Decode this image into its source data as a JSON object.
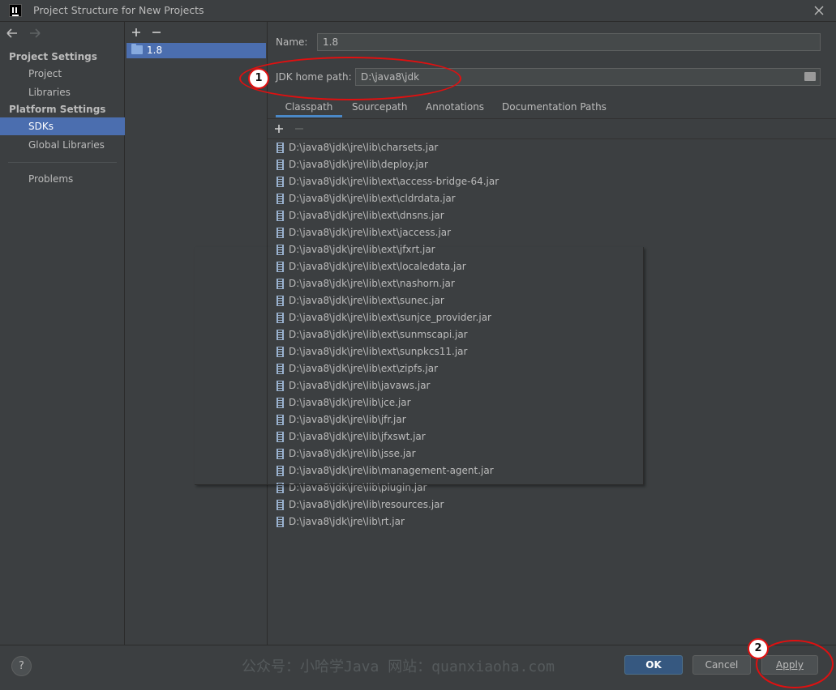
{
  "window": {
    "title": "Project Structure for New Projects",
    "app_icon": "intellij-icon",
    "close_icon": "close-icon"
  },
  "left_nav": {
    "back_icon": "arrow-left-icon",
    "forward_icon": "arrow-right-icon",
    "sections": [
      {
        "label": "Project Settings",
        "items": [
          "Project",
          "Libraries"
        ]
      },
      {
        "label": "Platform Settings",
        "items": [
          "SDKs",
          "Global Libraries"
        ]
      }
    ],
    "selected": "SDKs",
    "problems": "Problems"
  },
  "sdk_list": {
    "add_icon": "plus-icon",
    "remove_icon": "minus-icon",
    "items": [
      "1.8"
    ]
  },
  "detail": {
    "name_label": "Name:",
    "name_value": "1.8",
    "jdk_label": "JDK home path:",
    "jdk_value": "D:\\java8\\jdk",
    "tabs": [
      "Classpath",
      "Sourcepath",
      "Annotations",
      "Documentation Paths"
    ],
    "active_tab": "Classpath",
    "classpath": [
      "D:\\java8\\jdk\\jre\\lib\\charsets.jar",
      "D:\\java8\\jdk\\jre\\lib\\deploy.jar",
      "D:\\java8\\jdk\\jre\\lib\\ext\\access-bridge-64.jar",
      "D:\\java8\\jdk\\jre\\lib\\ext\\cldrdata.jar",
      "D:\\java8\\jdk\\jre\\lib\\ext\\dnsns.jar",
      "D:\\java8\\jdk\\jre\\lib\\ext\\jaccess.jar",
      "D:\\java8\\jdk\\jre\\lib\\ext\\jfxrt.jar",
      "D:\\java8\\jdk\\jre\\lib\\ext\\localedata.jar",
      "D:\\java8\\jdk\\jre\\lib\\ext\\nashorn.jar",
      "D:\\java8\\jdk\\jre\\lib\\ext\\sunec.jar",
      "D:\\java8\\jdk\\jre\\lib\\ext\\sunjce_provider.jar",
      "D:\\java8\\jdk\\jre\\lib\\ext\\sunmscapi.jar",
      "D:\\java8\\jdk\\jre\\lib\\ext\\sunpkcs11.jar",
      "D:\\java8\\jdk\\jre\\lib\\ext\\zipfs.jar",
      "D:\\java8\\jdk\\jre\\lib\\javaws.jar",
      "D:\\java8\\jdk\\jre\\lib\\jce.jar",
      "D:\\java8\\jdk\\jre\\lib\\jfr.jar",
      "D:\\java8\\jdk\\jre\\lib\\jfxswt.jar",
      "D:\\java8\\jdk\\jre\\lib\\jsse.jar",
      "D:\\java8\\jdk\\jre\\lib\\management-agent.jar",
      "D:\\java8\\jdk\\jre\\lib\\plugin.jar",
      "D:\\java8\\jdk\\jre\\lib\\resources.jar",
      "D:\\java8\\jdk\\jre\\lib\\rt.jar"
    ]
  },
  "bottom": {
    "help_label": "?",
    "watermark": "公众号：小哈学Java 网站：quanxiaoha.com",
    "ok_label": "OK",
    "cancel_label": "Cancel",
    "apply_label": "Apply"
  },
  "annotations": {
    "badge_1": "1",
    "badge_2": "2",
    "highlight_color": "#e01010"
  },
  "colors": {
    "background": "#3c3f41",
    "selection": "#4b6eaf",
    "ok_button": "#365880",
    "active_tab_underline": "#4a88c7"
  }
}
